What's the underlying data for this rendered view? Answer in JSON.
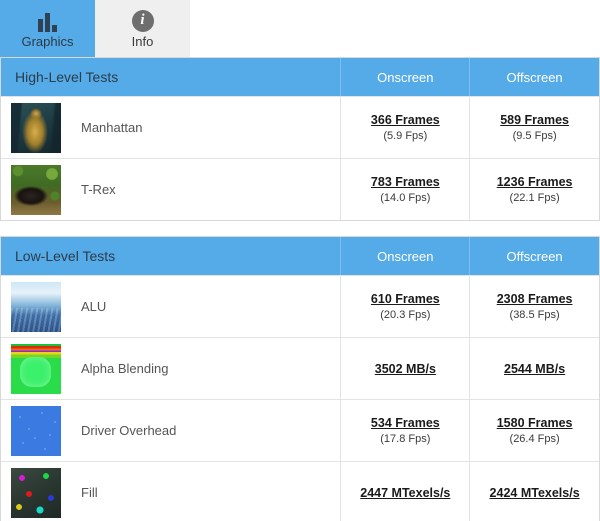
{
  "tabs": [
    {
      "label": "Graphics",
      "icon": "bar-chart-icon",
      "active": true
    },
    {
      "label": "Info",
      "icon": "info-circle-icon",
      "active": false
    }
  ],
  "colors": {
    "header_blue": "#55AAE8",
    "tab_inactive": "#EFEFEF",
    "border": "#d8d8d8"
  },
  "tables": [
    {
      "title": "High-Level Tests",
      "columns": [
        "Onscreen",
        "Offscreen"
      ],
      "rows": [
        {
          "name": "Manhattan",
          "thumb": "th-manhattan",
          "onscreen_main": "366 Frames",
          "onscreen_sub": "(5.9 Fps)",
          "offscreen_main": "589 Frames",
          "offscreen_sub": "(9.5 Fps)"
        },
        {
          "name": "T-Rex",
          "thumb": "th-trex",
          "onscreen_main": "783 Frames",
          "onscreen_sub": "(14.0 Fps)",
          "offscreen_main": "1236 Frames",
          "offscreen_sub": "(22.1 Fps)"
        }
      ]
    },
    {
      "title": "Low-Level Tests",
      "columns": [
        "Onscreen",
        "Offscreen"
      ],
      "rows": [
        {
          "name": "ALU",
          "thumb": "th-alu",
          "onscreen_main": "610 Frames",
          "onscreen_sub": "(20.3 Fps)",
          "offscreen_main": "2308 Frames",
          "offscreen_sub": "(38.5 Fps)"
        },
        {
          "name": "Alpha Blending",
          "thumb": "th-alpha",
          "onscreen_main": "3502 MB/s",
          "onscreen_sub": "",
          "offscreen_main": "2544 MB/s",
          "offscreen_sub": ""
        },
        {
          "name": "Driver Overhead",
          "thumb": "th-driver",
          "onscreen_main": "534 Frames",
          "onscreen_sub": "(17.8 Fps)",
          "offscreen_main": "1580 Frames",
          "offscreen_sub": "(26.4 Fps)"
        },
        {
          "name": "Fill",
          "thumb": "th-fill",
          "onscreen_main": "2447 MTexels/s",
          "onscreen_sub": "",
          "offscreen_main": "2424 MTexels/s",
          "offscreen_sub": ""
        }
      ]
    }
  ]
}
